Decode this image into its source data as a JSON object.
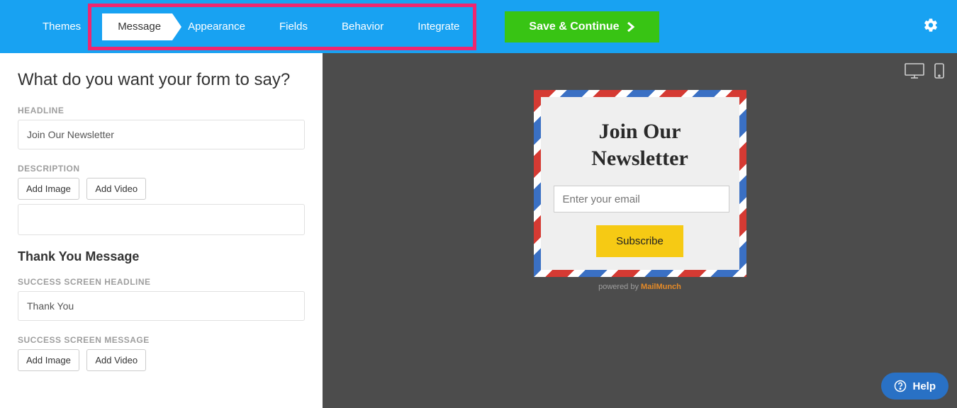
{
  "nav": {
    "themes": "Themes",
    "message": "Message",
    "appearance": "Appearance",
    "fields": "Fields",
    "behavior": "Behavior",
    "integrate": "Integrate",
    "save": "Save & Continue"
  },
  "left": {
    "question": "What do you want your form to say?",
    "headline_label": "HEADLINE",
    "headline_value": "Join Our Newsletter",
    "description_label": "DESCRIPTION",
    "add_image": "Add Image",
    "add_video": "Add Video",
    "thankyou_heading": "Thank You Message",
    "success_headline_label": "SUCCESS SCREEN HEADLINE",
    "success_headline_value": "Thank You",
    "success_message_label": "SUCCESS SCREEN MESSAGE"
  },
  "preview": {
    "title_line1": "Join Our",
    "title_line2": "Newsletter",
    "email_placeholder": "Enter your email",
    "subscribe": "Subscribe",
    "powered_by": "powered by ",
    "brand": "MailMunch"
  },
  "help": "Help"
}
